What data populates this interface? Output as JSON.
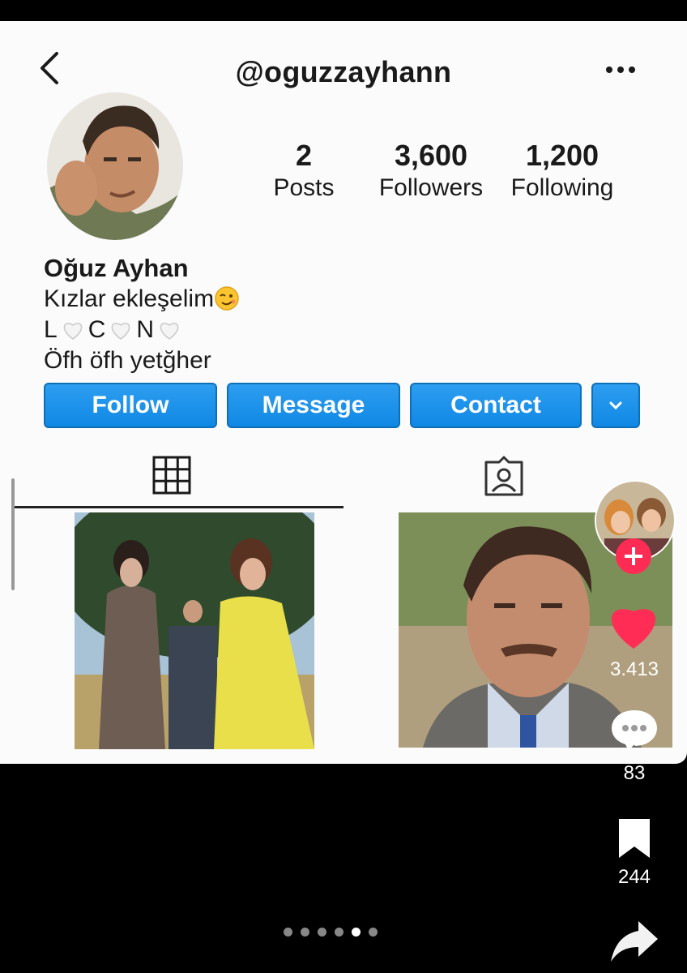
{
  "profile": {
    "username": "@oguzzayhann",
    "display_name": "Oğuz Ayhan",
    "bio_line1": "Kızlar ekleşelim",
    "bio_line2_letters": [
      "L",
      "C",
      "N"
    ],
    "bio_line3": "Öfh öfh yetğher"
  },
  "stats": {
    "posts_count": "2",
    "posts_label": "Posts",
    "followers_count": "3,600",
    "followers_label": "Followers",
    "following_count": "1,200",
    "following_label": "Following"
  },
  "actions": {
    "follow_label": "Follow",
    "message_label": "Message",
    "contact_label": "Contact"
  },
  "tabs": [
    "grid-icon",
    "tagged-user-icon"
  ],
  "side_rail": {
    "likes": "3.413",
    "comments": "83",
    "saves": "244"
  },
  "carousel": {
    "count": 6,
    "active": 5
  },
  "colors": {
    "accent": "#1088e4",
    "like": "#ff2d55",
    "follow_plus": "#fe2c55"
  }
}
